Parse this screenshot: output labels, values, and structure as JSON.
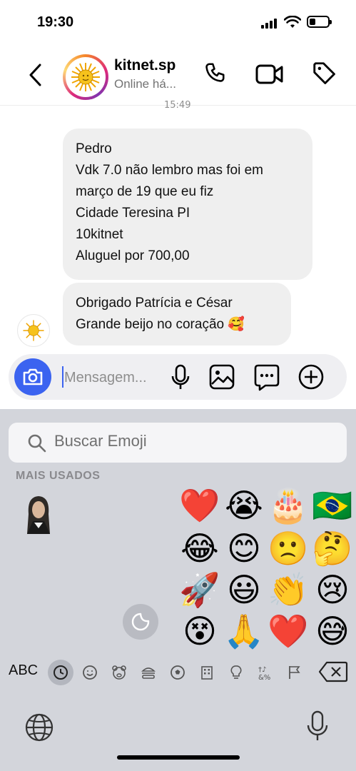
{
  "status_bar": {
    "time": "19:30"
  },
  "header": {
    "title": "kitnet.sp",
    "subtitle": "Online há..."
  },
  "conversation": {
    "timestamp": "15:49",
    "bubble1_lines": [
      "Pedro",
      "Vdk 7.0 não lembro mas foi em",
      "março de 19 que eu fiz",
      "Cidade Teresina PI",
      "10kitnet",
      "Aluguel por 700,00"
    ],
    "bubble2_lines": [
      "Obrigado Patrícia e César",
      "Grande beijo no coração 🥰"
    ]
  },
  "composer": {
    "placeholder": "Mensagem..."
  },
  "emoji_keyboard": {
    "search_placeholder": "Buscar Emoji",
    "section_label": "MAIS USADOS",
    "emojis": [
      "❤️",
      "😭",
      "🎂",
      "🇧🇷",
      "😂",
      "😊",
      "🙁",
      "🤔",
      "🚀",
      "😃",
      "👏",
      "😢",
      "😵",
      "🙏",
      "❤️",
      "😅"
    ],
    "abc_label": "ABC"
  },
  "colors": {
    "accent": "#3b63f0",
    "bubble": "#efefef",
    "keyboard": "#d3d5db"
  }
}
